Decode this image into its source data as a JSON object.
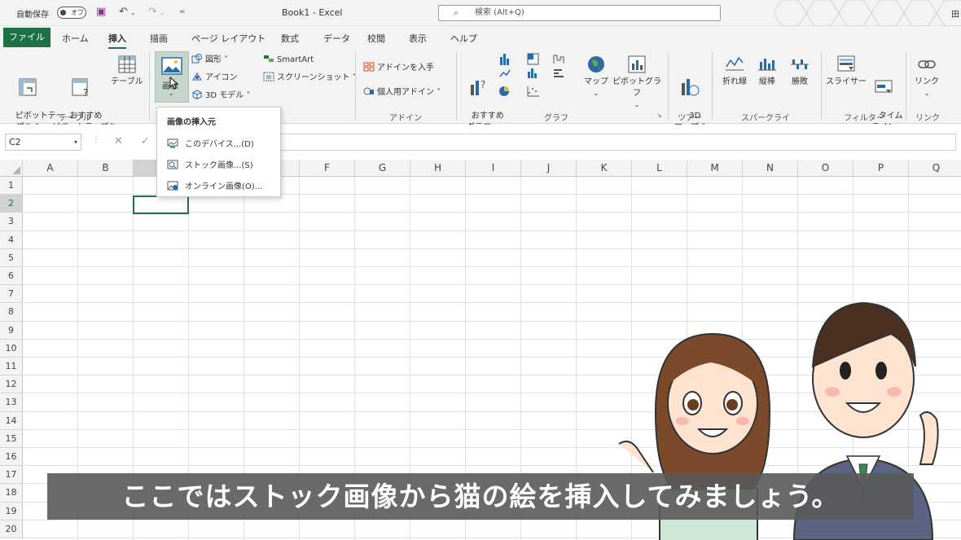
{
  "titlebar": {
    "autosave": "自動保存",
    "toggle": "オフ",
    "title": "Book1  -  Excel",
    "search_placeholder": "検索 (Alt+Q)",
    "user": "田"
  },
  "tabs": {
    "file": "ファイル",
    "items": [
      "ホーム",
      "挿入",
      "描画",
      "ページ レイアウト",
      "数式",
      "データ",
      "校閲",
      "表示",
      "ヘルプ"
    ],
    "active": "挿入"
  },
  "ribbon": {
    "table": {
      "group": "テーブル",
      "pivot": "ピボットテー\nブル ˅",
      "recommended": "おすすめ\nピボットテーブル",
      "table": "テーブル"
    },
    "illust": {
      "image": "画像",
      "shapes": "図形 ˅",
      "icons": "アイコン",
      "model3d": "3D モデル ˅",
      "smartart": "SmartArt",
      "screenshot": "スクリーンショット ˅"
    },
    "addins": {
      "group": "アドイン",
      "get": "アドインを入手",
      "personal": "個人用アドイン ˅"
    },
    "charts": {
      "group": "グラフ",
      "recommended": "おすすめ\nグラフ",
      "map": "マップ",
      "pivotchart": "ピボットグラフ"
    },
    "tours": {
      "group": "ツアー",
      "map3d": "3D\nマップ ˅"
    },
    "spark": {
      "group": "スパークライン",
      "line": "折れ線",
      "column": "縦棒",
      "winloss": "勝敗"
    },
    "filter": {
      "group": "フィルター",
      "slicer": "スライサー",
      "timeline": "タイム\nライン"
    },
    "links": {
      "group": "リンク",
      "link": "リンク"
    }
  },
  "namebox": "C2",
  "columns": [
    "A",
    "B",
    "C",
    "D",
    "E",
    "F",
    "G",
    "H",
    "I",
    "J",
    "K",
    "L",
    "M",
    "N",
    "O",
    "P",
    "Q"
  ],
  "rows": [
    "1",
    "2",
    "3",
    "4",
    "5",
    "6",
    "7",
    "8",
    "9",
    "10",
    "11",
    "12",
    "13",
    "14",
    "15",
    "16",
    "17",
    "18",
    "19",
    "20"
  ],
  "menu": {
    "header": "画像の挿入元",
    "items": [
      "このデバイス...(D)",
      "ストック画像...(S)",
      "オンライン画像(O)..."
    ]
  },
  "caption": "ここではストック画像から猫の絵を挿入してみましょう。",
  "colors": {
    "excel_green": "#1e7145",
    "selection": "#217346"
  }
}
